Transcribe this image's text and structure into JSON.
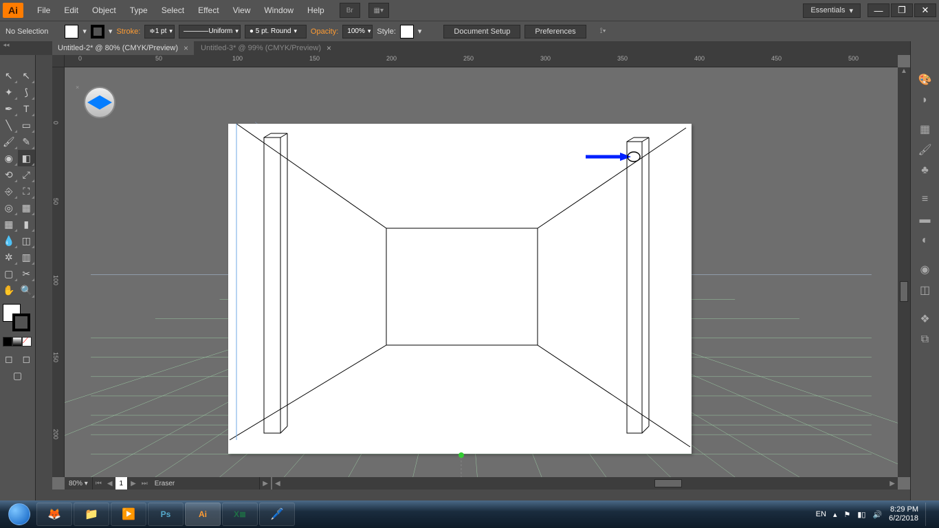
{
  "app": {
    "logo": "Ai"
  },
  "menu": {
    "file": "File",
    "edit": "Edit",
    "object": "Object",
    "type": "Type",
    "select": "Select",
    "effect": "Effect",
    "view": "View",
    "window": "Window",
    "help": "Help"
  },
  "workspace_switcher": "Essentials",
  "control": {
    "selection": "No Selection",
    "stroke_label": "Stroke:",
    "stroke_weight": "1 pt",
    "profile": "Uniform",
    "brush": "5 pt. Round",
    "opacity_label": "Opacity:",
    "opacity": "100%",
    "style_label": "Style:",
    "doc_setup": "Document Setup",
    "preferences": "Preferences"
  },
  "tabs": {
    "0": {
      "label": "Untitled-2* @ 80% (CMYK/Preview)"
    },
    "1": {
      "label": "Untitled-3* @ 99% (CMYK/Preview)"
    }
  },
  "ruler_h": [
    "0",
    "50",
    "100",
    "150",
    "200",
    "250",
    "300",
    "350",
    "400",
    "450",
    "500"
  ],
  "ruler_v": [
    "0",
    "50",
    "100",
    "150",
    "200"
  ],
  "status": {
    "zoom": "80%",
    "page": "1",
    "tool": "Eraser"
  },
  "systray": {
    "lang": "EN",
    "time": "8:29 PM",
    "date": "6/2/2018"
  },
  "colors": {
    "fill": "#ffffff",
    "stroke": "#000000",
    "grid_left": "#5a8dd6",
    "grid_floor": "#7ec28a",
    "annotation": "#0020ff"
  }
}
